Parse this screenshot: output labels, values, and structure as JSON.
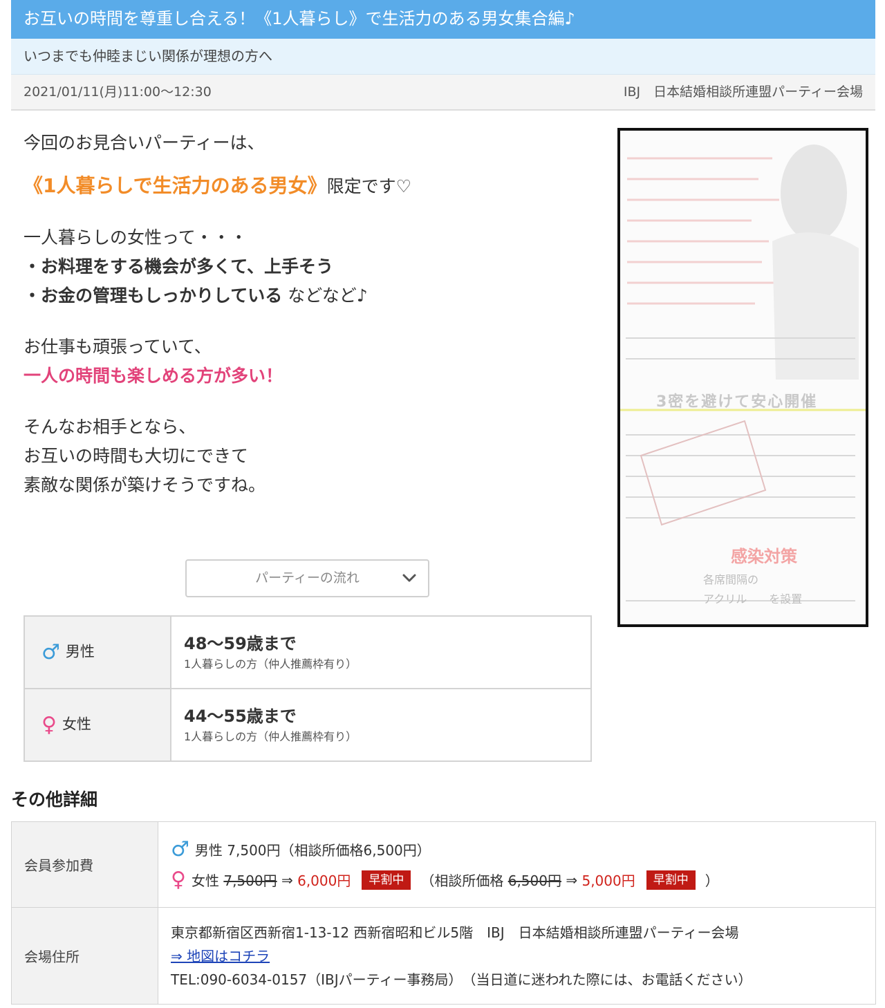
{
  "header": {
    "title": "お互いの時間を尊重し合える！《1人暮らし》で生活力のある男女集合編♪",
    "subtitle": "いつまでも仲睦まじい関係が理想の方へ",
    "datetime": "2021/01/11(月)11:00〜12:30",
    "venue": "IBJ　日本結婚相談所連盟パーティー会場"
  },
  "intro": {
    "line1": "今回のお見合いパーティーは、",
    "highlight": "《1人暮らしで生活力のある男女》",
    "highlight_suffix": "限定です♡",
    "line3": "一人暮らしの女性って・・・",
    "bullet1": "・お料理をする機会が多くて、上手そう",
    "bullet2": "・お金の管理もしっかりしている",
    "bullet2_suffix": " などなど♪",
    "line6": "お仕事も頑張っていて、",
    "pink_line": "一人の時間も楽しめる方が多い！",
    "line8": "そんなお相手となら、",
    "line9": "お互いの時間も大切にできて",
    "line10": "素敵な関係が築けそうですね。"
  },
  "flyer": {
    "text1": "3密を避けて安心開催",
    "text2": "感染対策",
    "text3": "各席間隔の",
    "text4": "アクリル　　を設置"
  },
  "dropdown": {
    "label": "パーティーの流れ"
  },
  "age_table": {
    "male": {
      "symbol": "♂",
      "label": "男性",
      "range": "48〜59歳まで",
      "condition": "1人暮らしの方（仲人推薦枠有り）"
    },
    "female": {
      "symbol": "♀",
      "label": "女性",
      "range": "44〜55歳まで",
      "condition": "1人暮らしの方（仲人推薦枠有り）"
    }
  },
  "details": {
    "heading": "その他詳細",
    "fee": {
      "label": "会員参加費",
      "male_symbol": "♂",
      "male_text": "男性 7,500円（相談所価格6,500円）",
      "female_symbol": "♀",
      "female_label": "女性",
      "female_old": "7,500円",
      "arrow": "⇒",
      "female_new": "6,000円",
      "badge": "早割中",
      "agency_prefix": "（相談所価格",
      "agency_old": "6,500円",
      "agency_new": "5,000円",
      "close_paren": "）"
    },
    "address": {
      "label": "会場住所",
      "line1": "東京都新宿区西新宿1-13-12 西新宿昭和ビル5階　IBJ　日本結婚相談所連盟パーティー会場",
      "map_link": "⇒ 地図はコチラ",
      "tel": "TEL:090-6034-0157（IBJパーティー事務局）　（当日道に迷われた際には、お電話ください）"
    }
  },
  "colors": {
    "title_bar": "#5aabe9",
    "subtitle_bar": "#e6f3fc",
    "highlight_orange": "#f28c28",
    "pink": "#e2437a",
    "sale_red": "#d0231c",
    "badge_red": "#c01a14",
    "male_blue": "#3b9bd8",
    "female_pink": "#e94a8a",
    "link_blue": "#1d44b8"
  }
}
